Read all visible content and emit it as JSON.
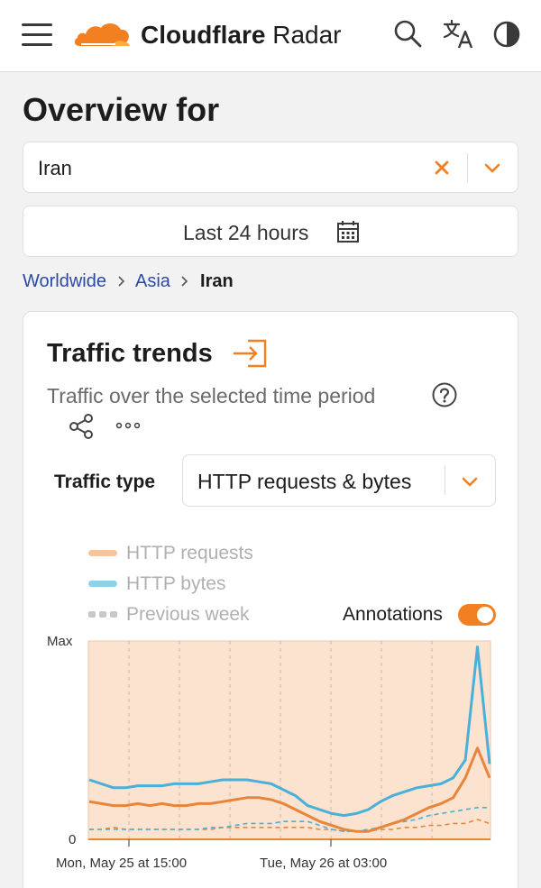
{
  "header": {
    "brand_bold": "Cloudflare",
    "brand_light": " Radar"
  },
  "overview": {
    "title": "Overview for",
    "location_value": "Iran",
    "time_range": "Last 24 hours"
  },
  "breadcrumb": {
    "items": [
      "Worldwide",
      "Asia"
    ],
    "current": "Iran"
  },
  "card": {
    "title": "Traffic trends",
    "subtitle": "Traffic over the selected time period",
    "traffic_type_label": "Traffic type",
    "traffic_type_value": "HTTP requests & bytes",
    "legend": [
      {
        "label": "HTTP requests",
        "color": "#f8c49a",
        "style": "solid"
      },
      {
        "label": "HTTP bytes",
        "color": "#8fd0ec",
        "style": "solid"
      },
      {
        "label": "Previous week",
        "color": "#c8c8c8",
        "style": "dashed"
      }
    ],
    "annotations_label": "Annotations",
    "annotations_on": true
  },
  "colors": {
    "accent": "#f38020",
    "link": "#2c48a8",
    "requests_line": "#e8853a",
    "bytes_line": "#4aafd9",
    "plot_bg": "#fbe3d0"
  },
  "chart_data": {
    "type": "line",
    "ylabels": [
      "Max",
      "0"
    ],
    "xticklabels": [
      "Mon, May 25 at 15:00",
      "Tue, May 26 at 03:00"
    ],
    "grid": true,
    "series": [
      {
        "name": "HTTP requests",
        "values": [
          0.19,
          0.18,
          0.17,
          0.17,
          0.18,
          0.17,
          0.18,
          0.17,
          0.17,
          0.18,
          0.18,
          0.19,
          0.2,
          0.21,
          0.21,
          0.2,
          0.18,
          0.15,
          0.12,
          0.09,
          0.07,
          0.05,
          0.04,
          0.04,
          0.06,
          0.08,
          0.1,
          0.13,
          0.16,
          0.18,
          0.21,
          0.31,
          0.46,
          0.31
        ]
      },
      {
        "name": "HTTP bytes",
        "values": [
          0.3,
          0.28,
          0.26,
          0.26,
          0.27,
          0.27,
          0.27,
          0.28,
          0.28,
          0.28,
          0.29,
          0.3,
          0.3,
          0.3,
          0.29,
          0.28,
          0.25,
          0.22,
          0.17,
          0.15,
          0.13,
          0.12,
          0.13,
          0.15,
          0.19,
          0.22,
          0.24,
          0.26,
          0.27,
          0.28,
          0.31,
          0.4,
          0.97,
          0.38
        ]
      },
      {
        "name": "Previous week (requests)",
        "values": [
          0.05,
          0.05,
          0.06,
          0.05,
          0.05,
          0.05,
          0.05,
          0.05,
          0.05,
          0.05,
          0.05,
          0.06,
          0.06,
          0.06,
          0.06,
          0.06,
          0.06,
          0.06,
          0.06,
          0.05,
          0.05,
          0.04,
          0.04,
          0.04,
          0.05,
          0.05,
          0.06,
          0.06,
          0.07,
          0.07,
          0.08,
          0.08,
          0.1,
          0.08
        ]
      },
      {
        "name": "Previous week (bytes)",
        "values": [
          0.05,
          0.05,
          0.05,
          0.05,
          0.05,
          0.05,
          0.05,
          0.05,
          0.05,
          0.05,
          0.06,
          0.06,
          0.07,
          0.08,
          0.08,
          0.08,
          0.09,
          0.09,
          0.09,
          0.07,
          0.05,
          0.04,
          0.04,
          0.05,
          0.06,
          0.08,
          0.09,
          0.1,
          0.12,
          0.13,
          0.14,
          0.15,
          0.16,
          0.16
        ]
      }
    ]
  }
}
